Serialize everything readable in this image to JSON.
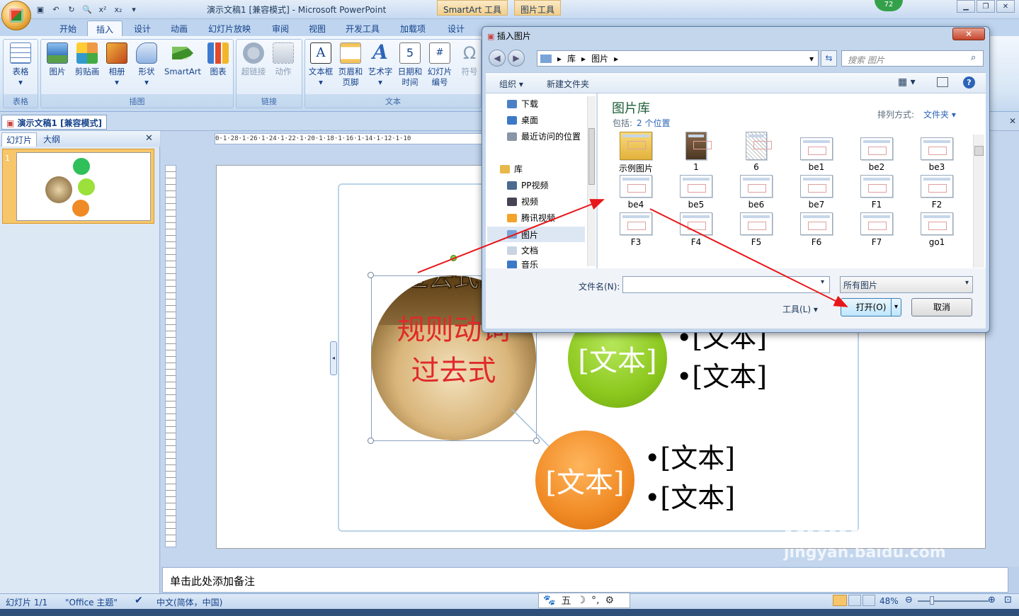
{
  "window": {
    "title": "演示文稿1 [兼容模式] - Microsoft PowerPoint",
    "context_tab_smartart": "SmartArt 工具",
    "context_tab_picture": "图片工具",
    "badge": "72"
  },
  "tabs": [
    "开始",
    "插入",
    "设计",
    "动画",
    "幻灯片放映",
    "审阅",
    "视图",
    "开发工具",
    "加载项",
    "设计"
  ],
  "active_tab": "插入",
  "ribbon": {
    "groups": [
      {
        "name": "表格",
        "buttons": [
          "表格"
        ]
      },
      {
        "name": "插图",
        "buttons": [
          "图片",
          "剪贴画",
          "相册",
          "形状",
          "SmartArt",
          "图表"
        ]
      },
      {
        "name": "链接",
        "buttons": [
          "超链接",
          "动作"
        ]
      },
      {
        "name": "文本",
        "buttons": [
          "文本框",
          "页眉和页脚",
          "艺术字",
          "日期和时间",
          "幻灯片编号",
          "符号"
        ]
      }
    ],
    "btn_labels": {
      "table": "表格",
      "picture": "图片",
      "clipart": "剪贴画",
      "album": "相册",
      "shapes": "形状",
      "smartart": "SmartArt",
      "chart": "图表",
      "hyperlink": "超链接",
      "action": "动作",
      "textbox": "文本框",
      "header1": "页眉和",
      "header2": "页脚",
      "wordart": "艺术字",
      "date1": "日期和",
      "date2": "时间",
      "slidenum1": "幻灯片",
      "slidenum2": "编号",
      "symbol": "符号"
    }
  },
  "document_tab": "演示文稿1 [兼容模式]",
  "left_pane": {
    "tab_slides": "幻灯片",
    "tab_outline": "大纲",
    "slide_number": "1"
  },
  "ruler": {
    "h": "0·1·28·1·26·1·24·1·22·1·20·1·18·1·16·1·14·1·12·1·10"
  },
  "slide": {
    "picture_text_top": "过去式的",
    "picture_text_line1": "规则动词",
    "picture_text_line2": "过去式",
    "green_label": "[文本]",
    "orange_label": "[文本]",
    "bullets": [
      "•[文本]",
      "•[文本]",
      "•[文本]",
      "•[文本]"
    ]
  },
  "notes_placeholder": "单击此处添加备注",
  "status": {
    "slide": "幻灯片 1/1",
    "theme": "\"Office 主题\"",
    "language": "中文(简体，中国)",
    "zoom": "48%",
    "ime": [
      "五",
      "☽",
      "°,",
      "⚙"
    ]
  },
  "dialog": {
    "title": "插入图片",
    "breadcrumb": [
      "库",
      "图片"
    ],
    "search_placeholder": "搜索 图片",
    "organize": "组织 ▾",
    "new_folder": "新建文件夹",
    "nav": [
      "下载",
      "桌面",
      "最近访问的位置",
      "库",
      "PP视频",
      "视频",
      "腾讯视频",
      "图片",
      "文档",
      "音乐"
    ],
    "library_title": "图片库",
    "includes_label": "包括:",
    "includes_link": "2 个位置",
    "arrange_label": "排列方式:",
    "arrange_value": "文件夹 ▾",
    "files": [
      "示例图片",
      "1",
      "6",
      "be1",
      "be2",
      "be3",
      "be4",
      "be5",
      "be6",
      "be7",
      "F1",
      "F2",
      "F3",
      "F4",
      "F5",
      "F6",
      "F7",
      "go1"
    ],
    "filename_label": "文件名(N):",
    "filename_value": "",
    "filter": "所有图片",
    "tools": "工具(L)",
    "open": "打开(O)",
    "cancel": "取消"
  },
  "watermark": {
    "brand": "Baidu 经验",
    "url": "jingyan.baidu.com"
  },
  "colors": {
    "green": "#8cc81e",
    "orange": "#f08a24",
    "ribbon": "#dbe8f6",
    "arrow": "#e8161a"
  }
}
